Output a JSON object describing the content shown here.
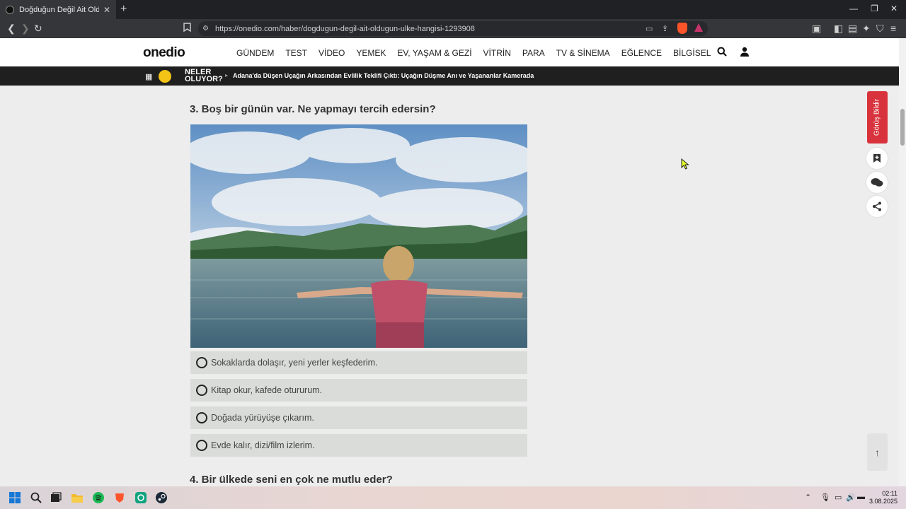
{
  "browser": {
    "tab_title": "Doğduğun Değil Ait Olduğun Ül",
    "url": "https://onedio.com/haber/dogdugun-degil-ait-oldugun-ulke-hangisi-1293908"
  },
  "site": {
    "logo": "onedio",
    "nav": [
      "GÜNDEM",
      "TEST",
      "VİDEO",
      "YEMEK",
      "EV, YAŞAM & GEZİ",
      "VİTRİN",
      "PARA",
      "TV & SİNEMA",
      "EĞLENCE",
      "BİLGİSEL"
    ],
    "ticker_label": "NELER OLUYOR?",
    "ticker_text": "Adana'da Düşen Uçağın Arkasından Evlilik Teklifi Çıktı: Uçağın Düşme Anı ve Yaşananlar Kamerada"
  },
  "quiz": {
    "question3": "3. Boş bir günün var. Ne yapmayı tercih edersin?",
    "options": [
      "Sokaklarda dolaşır, yeni yerler keşfederim.",
      "Kitap okur, kafede otururum.",
      "Doğada yürüyüşe çıkarım.",
      "Evde kalır, dizi/film izlerim."
    ],
    "question4": "4. Bir ülkede seni en çok ne mutlu eder?"
  },
  "rail": {
    "feedback": "Görüş Bildir"
  },
  "taskbar": {
    "time": "02:11",
    "date": "3.08.2025"
  },
  "colors": {
    "accent_red": "#d8333c",
    "option_bg": "#d9dcd9",
    "ticker_badge": "#f3c316"
  }
}
